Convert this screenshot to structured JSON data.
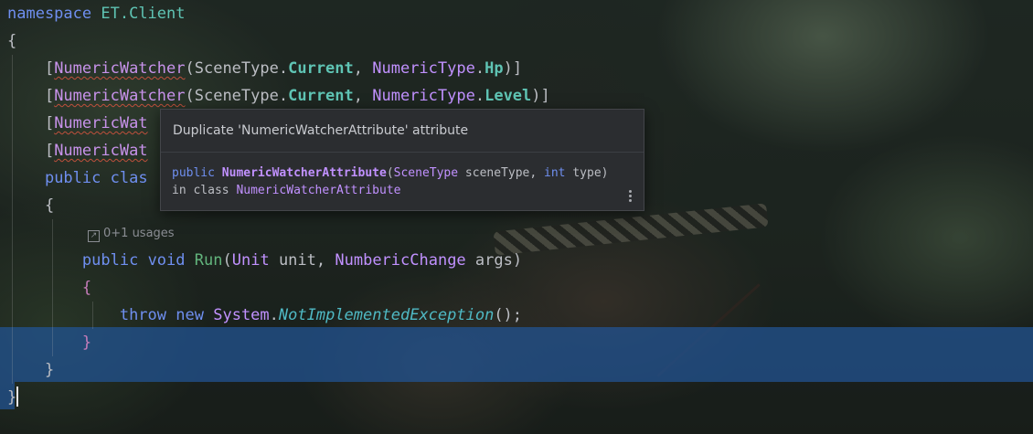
{
  "editor": {
    "lines": {
      "l1_kw": "namespace",
      "l1_ns": "ET.Client",
      "l2": "{",
      "attr_name": "NumericWatcher",
      "scene_type": "SceneType",
      "current": "Current",
      "numeric_type": "NumericType",
      "hp": "Hp",
      "level": "Level",
      "l5_prefix": "[NumericWat",
      "l6_prefix": "[NumericWat",
      "l7_kw": "public",
      "l7_rest": "clas",
      "l8": "{",
      "usages": "0+1 usages",
      "run_public": "public",
      "run_void": "void",
      "run_name": "Run",
      "run_unit_type": "Unit",
      "run_unit_name": "unit",
      "run_change_type": "NumbericChange",
      "run_args": "args",
      "l10": "{",
      "throw_kw": "throw",
      "new_kw": "new",
      "system": "System",
      "exception": "NotImplementedException",
      "l12": "}",
      "l13": "}",
      "l14": "}"
    }
  },
  "tooltip": {
    "title": "Duplicate 'NumericWatcherAttribute' attribute",
    "sig_public": "public",
    "sig_name": "NumericWatcherAttribute",
    "sig_scene_type": "SceneType",
    "sig_scene_param": "sceneType",
    "sig_int": "int",
    "sig_type_param": "type",
    "in_class_text": "in class",
    "in_class_name": "NumericWatcherAttribute",
    "more_icon": "more-vertical-icon"
  },
  "colors": {
    "selection": "#2155a0",
    "keyword": "#6f8ff0",
    "type": "#c191ff",
    "member": "#5fc4b4",
    "method": "#56a8f5"
  }
}
